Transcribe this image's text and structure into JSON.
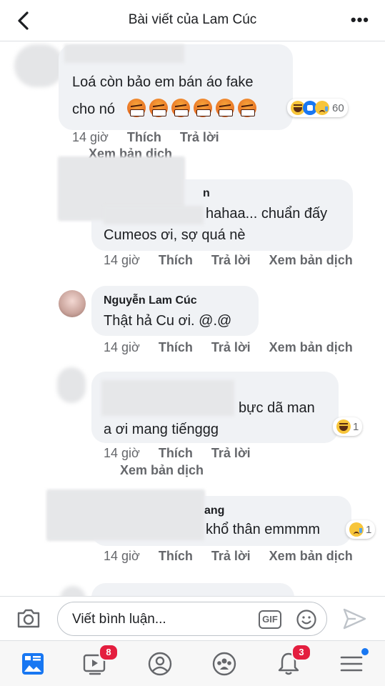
{
  "header": {
    "title": "Bài viết của Lam Cúc"
  },
  "comments": [
    {
      "name": "",
      "text_lines": [
        "Loá còn bảo em bán áo fake",
        "cho nó"
      ],
      "reaction_count": "60",
      "meta": {
        "time": "14 giờ",
        "like": "Thích",
        "reply": "Trả lời",
        "translate": "Xem bản dịch"
      }
    },
    {
      "name": "n",
      "text_lines": [
        "hahaa... chuẩn đấy",
        "Cumeos ơi, sợ quá nè"
      ],
      "meta": {
        "time": "14 giờ",
        "like": "Thích",
        "reply": "Trả lời",
        "translate": "Xem bản dịch"
      }
    },
    {
      "name": "Nguyễn Lam Cúc",
      "text_lines": [
        "Thật hả Cu ơi. @.@"
      ],
      "meta": {
        "time": "14 giờ",
        "like": "Thích",
        "reply": "Trả lời",
        "translate": "Xem bản dịch"
      }
    },
    {
      "name": "",
      "text_lines": [
        "bực dã man",
        "a ơi mang tiếnggg"
      ],
      "reaction_count": "1",
      "meta": {
        "time": "14 giờ",
        "like": "Thích",
        "reply": "Trả lời",
        "translate": "Xem bản dịch"
      }
    },
    {
      "name": "ang",
      "text_lines": [
        "khổ thân emmmm"
      ],
      "reaction_count": "1",
      "meta": {
        "time": "14 giờ",
        "like": "Thích",
        "reply": "Trả lời",
        "translate": "Xem bản dịch"
      }
    }
  ],
  "composer": {
    "placeholder": "Viết bình luận...",
    "gif_label": "GIF"
  },
  "tabbar": {
    "watch_badge": "8",
    "notifications_badge": "3"
  },
  "icons": [
    "back-arrow-icon",
    "more-dots-icon",
    "camera-icon",
    "gif-icon",
    "smiley-icon",
    "send-icon",
    "news-feed-icon",
    "watch-icon",
    "profile-icon",
    "groups-icon",
    "bell-icon",
    "menu-icon"
  ],
  "colors": {
    "accent": "#1877f2",
    "badge": "#e41e3f",
    "bubble": "#f0f2f5",
    "meta_text": "#65676b"
  }
}
